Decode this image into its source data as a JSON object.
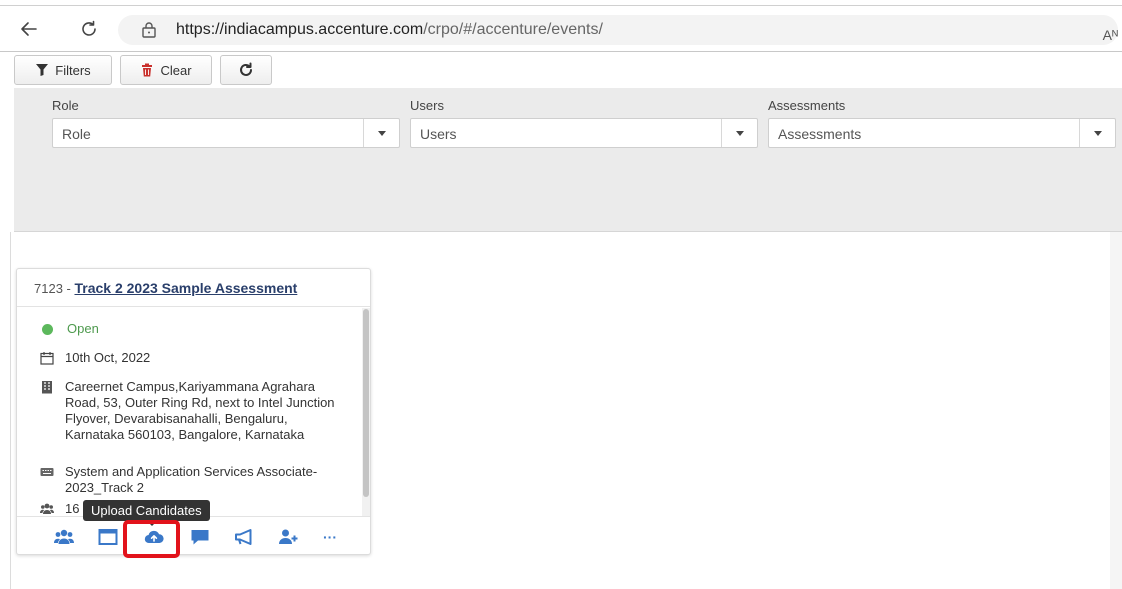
{
  "browser": {
    "url_host": "https://indiacampus.accenture.com",
    "url_path": "/crpo/#/accenture/events/",
    "read_aloud": "Aᴺ"
  },
  "toolbar": {
    "filters_label": "Filters",
    "clear_label": "Clear"
  },
  "filters": {
    "role": {
      "label": "Role",
      "value": "Role"
    },
    "users": {
      "label": "Users",
      "value": "Users"
    },
    "assessments": {
      "label": "Assessments",
      "value": "Assessments"
    }
  },
  "card": {
    "id_prefix": "7123 - ",
    "title": "Track 2 2023 Sample Assessment",
    "status": "Open",
    "date": "10th Oct, 2022",
    "address": "Careernet Campus,Kariyammana Agrahara Road, 53, Outer Ring Rd, next to Intel Junction Flyover, Devarabisanahalli, Bengaluru, Karnataka 560103, Bangalore, Karnataka",
    "role": "System and Application Services Associate-2023_Track 2",
    "count": "16",
    "more_label": "···"
  },
  "tooltip": {
    "text": "Upload Candidates"
  },
  "colors": {
    "accent_blue": "#3a78c8",
    "status_green": "#5cb85c",
    "highlight_red": "#e2121b",
    "panel_gray": "#ebebeb"
  }
}
